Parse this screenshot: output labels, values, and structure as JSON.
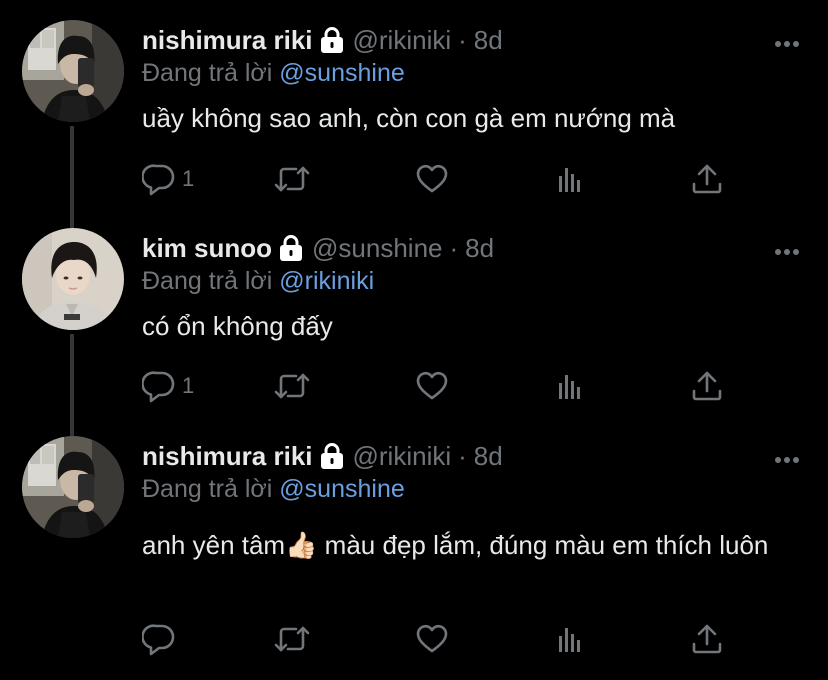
{
  "colors": {
    "background": "#000000",
    "text_primary": "#e7e9ea",
    "text_secondary": "#71767b",
    "mention": "#6b9fe0",
    "thread_line": "#333639"
  },
  "tweets": [
    {
      "display_name": "nishimura riki",
      "protected_icon": "lock-icon",
      "handle": "@rikiniki",
      "separator": "·",
      "time": "8d",
      "reply_prefix": "Đang trả lời",
      "reply_to": "@sunshine",
      "text": "uầy không sao anh, còn con gà em nướng mà",
      "reply_count": "1",
      "icons": [
        "reply-icon",
        "retweet-icon",
        "like-icon",
        "views-icon",
        "share-icon"
      ]
    },
    {
      "display_name": "kim sunoo",
      "protected_icon": "lock-icon",
      "handle": "@sunshine",
      "separator": "·",
      "time": "8d",
      "reply_prefix": "Đang trả lời",
      "reply_to": "@rikiniki",
      "text": "có ổn không đấy",
      "reply_count": "1",
      "icons": [
        "reply-icon",
        "retweet-icon",
        "like-icon",
        "views-icon",
        "share-icon"
      ]
    },
    {
      "display_name": "nishimura riki",
      "protected_icon": "lock-icon",
      "handle": "@rikiniki",
      "separator": "·",
      "time": "8d",
      "reply_prefix": "Đang trả lời",
      "reply_to": "@sunshine",
      "text": "anh yên tâm👍🏻  màu đẹp lắm, đúng màu em thích luôn",
      "reply_count": "",
      "icons": [
        "reply-icon",
        "retweet-icon",
        "like-icon",
        "views-icon",
        "share-icon"
      ]
    }
  ]
}
